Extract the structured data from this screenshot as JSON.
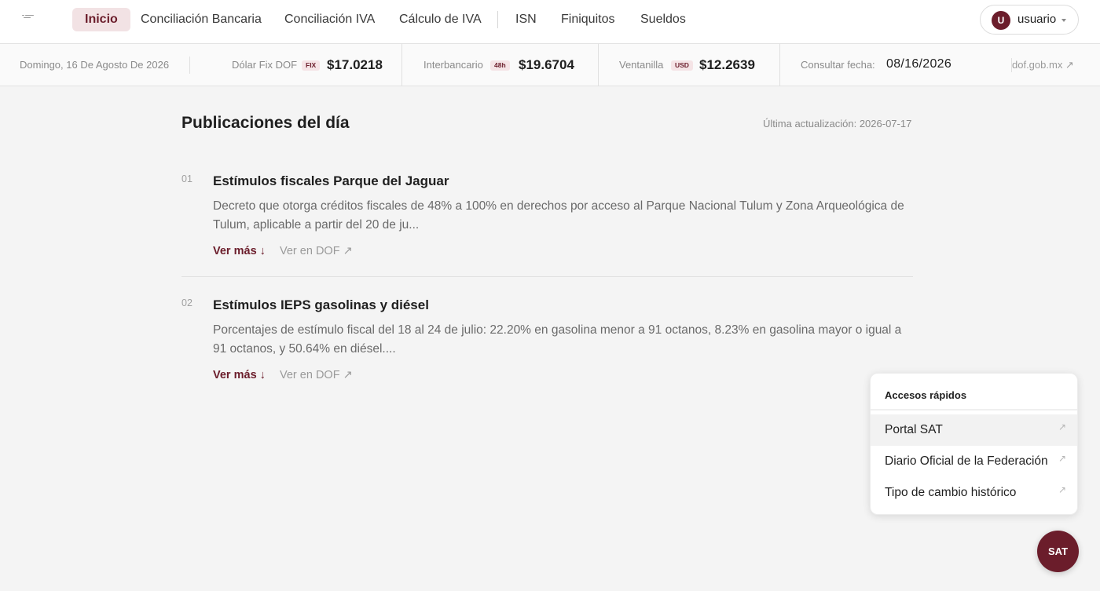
{
  "nav": {
    "items": [
      {
        "label": "Inicio",
        "active": true
      },
      {
        "label": "Conciliación Bancaria"
      },
      {
        "label": "Conciliación IVA"
      },
      {
        "label": "Cálculo de IVA"
      },
      {
        "label": "ISN"
      },
      {
        "label": "Finiquitos"
      },
      {
        "label": "Sueldos"
      }
    ],
    "user": {
      "initial": "U",
      "name": "usuario"
    }
  },
  "rates": {
    "date_text": "Domingo, 16 De Agosto De 2026",
    "dolar_fix": {
      "label": "Dólar Fix DOF",
      "badge": "FIX",
      "value": "$17.0218"
    },
    "interbancario": {
      "label": "Interbancario",
      "badge": "48h",
      "value": "$19.6704"
    },
    "ventanilla": {
      "label": "Ventanilla",
      "badge": "USD",
      "value": "$12.2639"
    },
    "consult": {
      "label": "Consultar fecha:",
      "value": "08/16/2026"
    },
    "link": "dof.gob.mx ↗"
  },
  "publications": {
    "title": "Publicaciones del día",
    "updated": "Última actualización: 2026-07-17",
    "items": [
      {
        "num": "01",
        "title": "Estímulos fiscales Parque del Jaguar",
        "desc": "Decreto que otorga créditos fiscales de 48% a 100% en derechos por acceso al Parque Nacional Tulum y Zona Arqueológica de Tulum, aplicable a partir del 20 de ju...",
        "more": "Ver más ↓",
        "dof": "Ver en DOF ↗"
      },
      {
        "num": "02",
        "title": "Estímulos IEPS gasolinas y diésel",
        "desc": "Porcentajes de estímulo fiscal del 18 al 24 de julio: 22.20% en gasolina menor a 91 octanos, 8.23% en gasolina mayor o igual a 91 octanos, y 50.64% en diésel....",
        "more": "Ver más ↓",
        "dof": "Ver en DOF ↗"
      }
    ]
  },
  "quick_access": {
    "title": "Accesos rápidos",
    "items": [
      {
        "label": "Portal SAT",
        "arrow": "↗"
      },
      {
        "label": "Diario Oficial de la Federación",
        "arrow": "↗"
      },
      {
        "label": "Tipo de cambio histórico",
        "arrow": "↗"
      }
    ]
  },
  "sat_button": "SAT",
  "colors": {
    "brand": "#6b1d2b",
    "brand_light": "#f2e2e4"
  }
}
